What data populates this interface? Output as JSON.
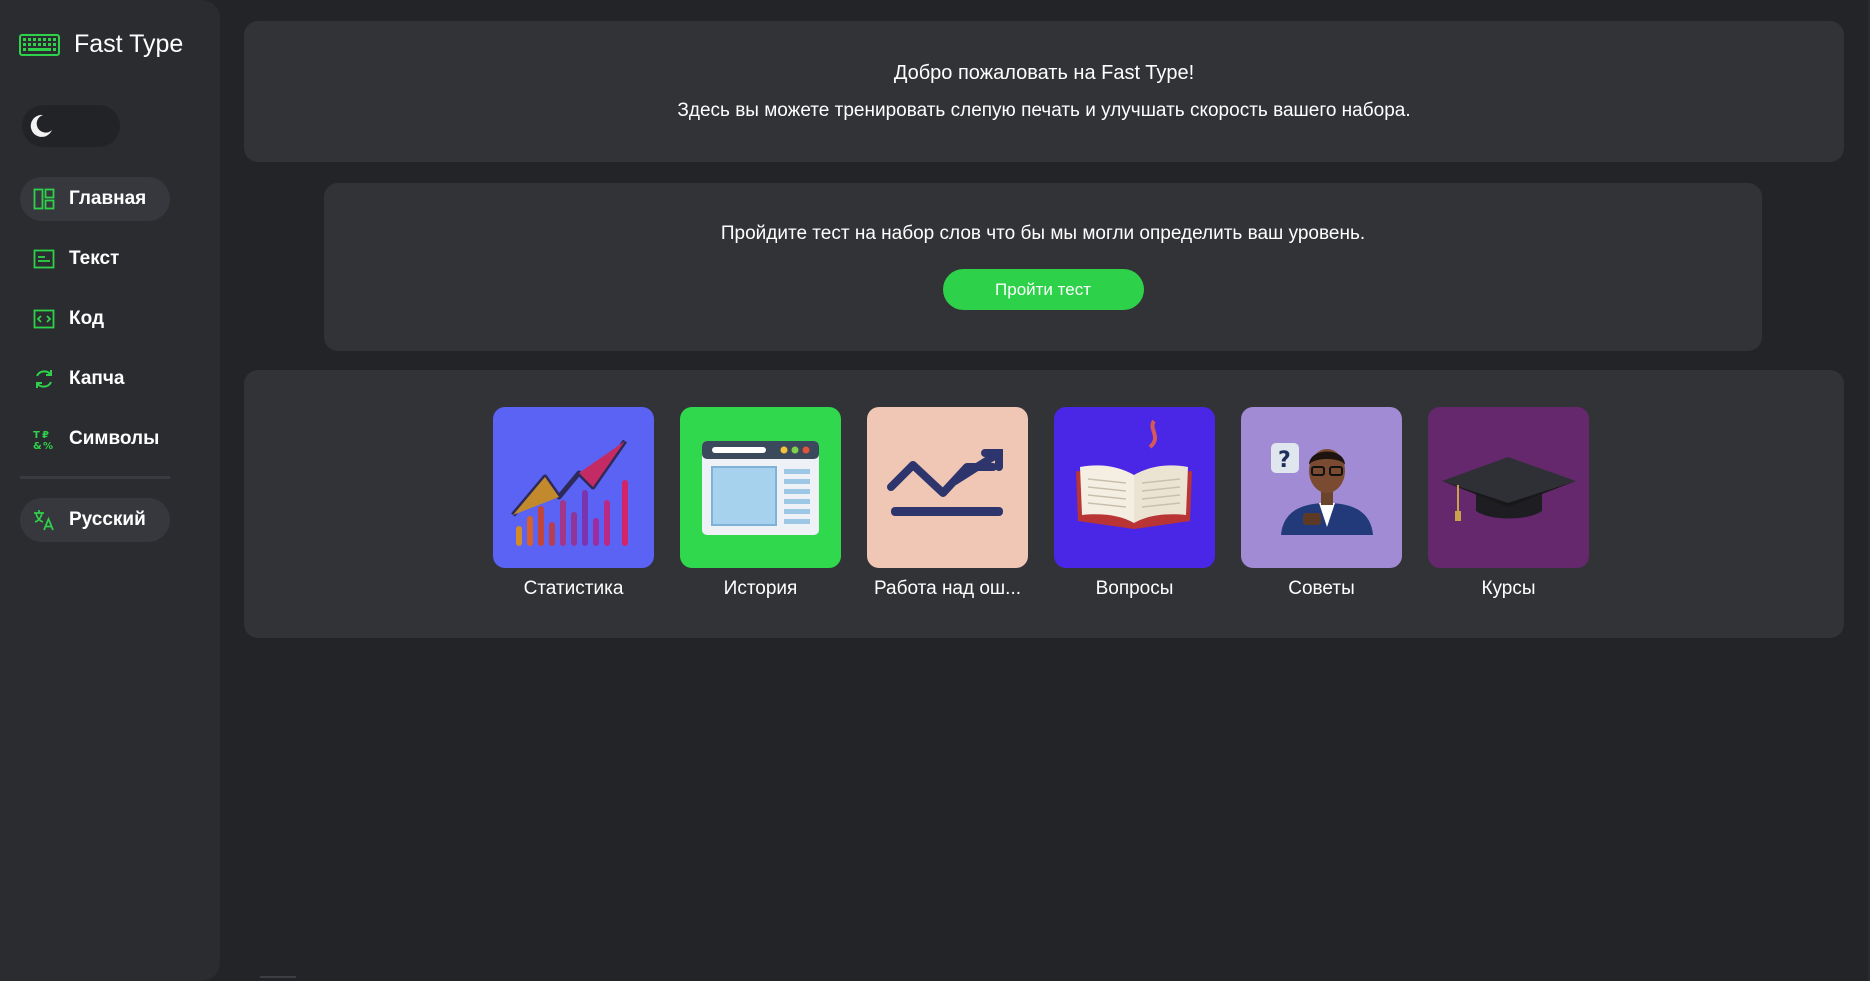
{
  "app": {
    "name": "Fast Type"
  },
  "sidebar": {
    "theme_toggle": {
      "icon": "moon-icon"
    },
    "items": [
      {
        "label": "Главная",
        "icon": "dashboard-icon",
        "active": true
      },
      {
        "label": "Текст",
        "icon": "text-icon",
        "active": false
      },
      {
        "label": "Код",
        "icon": "code-icon",
        "active": false
      },
      {
        "label": "Капча",
        "icon": "refresh-icon",
        "active": false
      },
      {
        "label": "Символы",
        "icon": "symbols-icon",
        "active": false
      }
    ],
    "language": {
      "label": "Русский",
      "icon": "translate-icon"
    }
  },
  "welcome": {
    "title": "Добро пожаловать на Fast Type!",
    "subtitle": "Здесь вы можете тренировать слепую печать и улучшать скорость вашего набора."
  },
  "test": {
    "prompt": "Пройдите тест на набор слов что бы мы могли определить ваш уровень.",
    "button_label": "Пройти тест"
  },
  "tiles": [
    {
      "label": "Статистика",
      "color": "#5b63f5",
      "icon": "chart-icon"
    },
    {
      "label": "История",
      "color": "#2fd84c",
      "icon": "browser-window-icon"
    },
    {
      "label": "Работа над ош...",
      "color": "#f0c6b4",
      "icon": "trend-arrow-icon"
    },
    {
      "label": "Вопросы",
      "color": "#4a26e6",
      "icon": "open-book-icon"
    },
    {
      "label": "Советы",
      "color": "#a08bd4",
      "icon": "advisor-icon"
    },
    {
      "label": "Курсы",
      "color": "#66286d",
      "icon": "graduation-cap-icon"
    }
  ],
  "colors": {
    "accent": "#2ed14a",
    "background": "#232427",
    "card": "#323337",
    "sidebar": "#2b2c30"
  }
}
